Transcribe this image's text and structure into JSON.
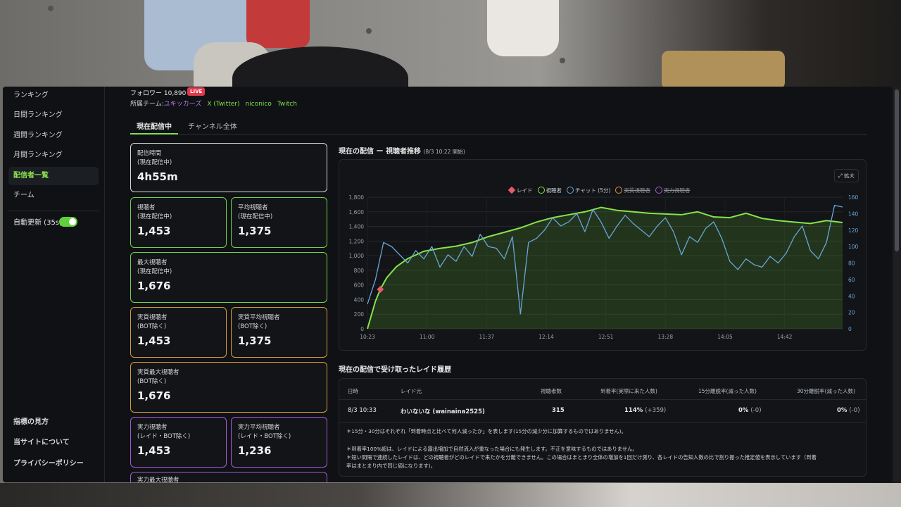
{
  "sidebar": {
    "items": [
      {
        "label": "ランキング",
        "active": false
      },
      {
        "label": "日間ランキング",
        "active": false
      },
      {
        "label": "週間ランキング",
        "active": false
      },
      {
        "label": "月間ランキング",
        "active": false
      },
      {
        "label": "配信者一覧",
        "active": true
      },
      {
        "label": "チーム",
        "active": false
      }
    ],
    "auto_update_label": "自動更新 (35s)",
    "auto_update_on": true,
    "footer_items": [
      "指標の見方",
      "当サイトについて",
      "プライバシーポリシー"
    ]
  },
  "profile": {
    "followers": "フォロワー 10,890",
    "live_badge": "LIVE",
    "team_prefix": "所属チーム:",
    "team_name": "ユキッカーズ",
    "links": [
      "X (Twitter)",
      "niconico",
      "Twitch"
    ]
  },
  "tabs": {
    "current": "現在配信中",
    "all": "チャンネル全体"
  },
  "stats": [
    {
      "label": "配信時間\n(現在配信中)",
      "value": "4h55m",
      "color": "white"
    },
    {
      "label": "視聴者\n(現在配信中)",
      "value": "1,453",
      "color": "green"
    },
    {
      "label": "平均視聴者\n(現在配信中)",
      "value": "1,375",
      "color": "green"
    },
    {
      "label": "最大視聴者\n(現在配信中)",
      "value": "1,676",
      "color": "green"
    },
    {
      "label": "実質視聴者\n(BOT除く)",
      "value": "1,453",
      "color": "orange"
    },
    {
      "label": "実質平均視聴者\n(BOT除く)",
      "value": "1,375",
      "color": "orange"
    },
    {
      "label": "実質最大視聴者\n(BOT除く)",
      "value": "1,676",
      "color": "orange"
    },
    {
      "label": "実力視聴者\n(レイド・BOT除く)",
      "value": "1,453",
      "color": "purple"
    },
    {
      "label": "実力平均視聴者\n(レイド・BOT除く)",
      "value": "1,236",
      "color": "purple"
    },
    {
      "label": "実力最大視聴者",
      "value": "",
      "color": "purple"
    }
  ],
  "chart": {
    "title": "現在の配信 ー 視聴者推移",
    "subtitle": "(8/3 10:22 開始)",
    "expand_label": "⤢ 拡大",
    "legend": [
      {
        "name": "レイド",
        "color": "#e85a6a",
        "off": false,
        "shape": "diamond"
      },
      {
        "name": "視聴者",
        "color": "#86e34a",
        "off": false
      },
      {
        "name": "チャット (5分)",
        "color": "#6aa5d8",
        "off": false
      },
      {
        "name": "実質視聴者",
        "color": "#d99a3c",
        "off": true
      },
      {
        "name": "実力視聴者",
        "color": "#a45ad6",
        "off": true
      }
    ],
    "colors": {
      "viewers": "#86e34a",
      "chat": "#6aa5d8",
      "raid": "#e85a6a"
    }
  },
  "chart_data": {
    "type": "line",
    "x_ticks": [
      "10:23",
      "11:00",
      "11:37",
      "12:14",
      "12:51",
      "13:28",
      "14:05",
      "14:42"
    ],
    "y_left_ticks": [
      "0",
      "200",
      "400",
      "600",
      "800",
      "1,000",
      "1,200",
      "1,400",
      "1,600",
      "1,800"
    ],
    "y_right_ticks": [
      "0",
      "20",
      "40",
      "60",
      "80",
      "100",
      "120",
      "140",
      "160"
    ],
    "ylim_left": [
      0,
      1800
    ],
    "ylim_right": [
      0,
      160
    ],
    "grid": true,
    "legend_position": "top-center",
    "series": [
      {
        "name": "視聴者",
        "axis": "left",
        "x_minutes_from_start": [
          0,
          5,
          8,
          12,
          18,
          25,
          35,
          45,
          55,
          65,
          75,
          85,
          95,
          105,
          115,
          125,
          135,
          145,
          155,
          165,
          175,
          185,
          195,
          205,
          215,
          225,
          235,
          245,
          255,
          265,
          275,
          285,
          295
        ],
        "values": [
          0,
          380,
          540,
          700,
          850,
          960,
          1060,
          1100,
          1130,
          1180,
          1260,
          1320,
          1380,
          1460,
          1520,
          1560,
          1600,
          1660,
          1620,
          1600,
          1580,
          1570,
          1560,
          1600,
          1530,
          1520,
          1580,
          1510,
          1480,
          1460,
          1440,
          1480,
          1453
        ]
      },
      {
        "name": "チャット (5分)",
        "axis": "right",
        "x_minutes_from_start": [
          0,
          5,
          10,
          15,
          20,
          25,
          30,
          35,
          40,
          45,
          50,
          55,
          60,
          65,
          70,
          75,
          80,
          85,
          90,
          95,
          100,
          105,
          110,
          115,
          120,
          125,
          130,
          135,
          140,
          145,
          150,
          155,
          160,
          165,
          170,
          175,
          180,
          185,
          190,
          195,
          200,
          205,
          210,
          215,
          220,
          225,
          230,
          235,
          240,
          245,
          250,
          255,
          260,
          265,
          270,
          275,
          280,
          285,
          290,
          295
        ],
        "values": [
          30,
          60,
          105,
          100,
          90,
          80,
          95,
          85,
          100,
          75,
          90,
          82,
          100,
          88,
          115,
          100,
          98,
          85,
          112,
          18,
          105,
          110,
          120,
          135,
          125,
          130,
          140,
          118,
          145,
          130,
          110,
          125,
          138,
          128,
          120,
          112,
          125,
          135,
          118,
          90,
          112,
          105,
          122,
          130,
          110,
          82,
          72,
          85,
          78,
          75,
          88,
          80,
          92,
          112,
          125,
          95,
          85,
          105,
          150,
          148
        ]
      }
    ],
    "annotations": [
      {
        "type": "raid",
        "x_minutes_from_start": 8,
        "value": 540
      }
    ]
  },
  "raid": {
    "title": "現在の配信で受け取ったレイド履歴",
    "headers": [
      "日時",
      "レイド元",
      "視聴者数",
      "到着率(実際に来た人数)",
      "15分離脱率(減った人数)",
      "30分離脱率(減った人数)"
    ],
    "rows": [
      {
        "date": "8/3 10:33",
        "source": "わいないな (wainaina2525)",
        "viewers": "315",
        "arrival": "114%",
        "arrival_sub": "(+359)",
        "leave15": "0%",
        "leave15_sub": "(-0)",
        "leave30": "0%",
        "leave30_sub": "(-0)"
      }
    ],
    "notes": [
      "＊15分・30分はそれぞれ「到着時点と比べて何人減ったか」を表します(15分の減少分に加算するものではありません)。",
      "＊到着率100%超は、レイドによる露出増加で自然流入が重なった場合にも発生します。不正を意味するものではありません。",
      "＊短い間隔で連続したレイドは、どの視聴者がどのレイドで来たかを分離できません。この場合はまとまり全体の増加を1回だけ測り、各レイドの告知人数の比で割り振った推定値を表示しています（到着",
      "率はまとまり内で同じ値になります)。"
    ]
  }
}
